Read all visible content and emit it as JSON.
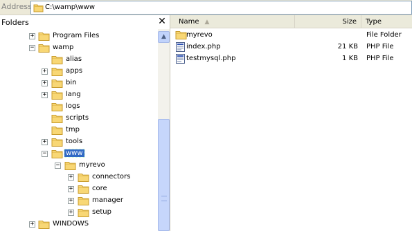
{
  "address": {
    "label": "Address",
    "path": "C:\\wamp\\www"
  },
  "folders_pane": {
    "title": "Folders",
    "close_glyph": "✕",
    "tree": [
      {
        "label": "Program Files",
        "expander": "+",
        "depth": 0,
        "selected": false
      },
      {
        "label": "wamp",
        "expander": "−",
        "depth": 0,
        "selected": false
      },
      {
        "label": "alias",
        "expander": "",
        "depth": 1,
        "selected": false
      },
      {
        "label": "apps",
        "expander": "+",
        "depth": 1,
        "selected": false
      },
      {
        "label": "bin",
        "expander": "+",
        "depth": 1,
        "selected": false
      },
      {
        "label": "lang",
        "expander": "+",
        "depth": 1,
        "selected": false
      },
      {
        "label": "logs",
        "expander": "",
        "depth": 1,
        "selected": false
      },
      {
        "label": "scripts",
        "expander": "",
        "depth": 1,
        "selected": false
      },
      {
        "label": "tmp",
        "expander": "",
        "depth": 1,
        "selected": false
      },
      {
        "label": "tools",
        "expander": "+",
        "depth": 1,
        "selected": false
      },
      {
        "label": "www",
        "expander": "−",
        "depth": 1,
        "selected": true
      },
      {
        "label": "myrevo",
        "expander": "−",
        "depth": 2,
        "selected": false
      },
      {
        "label": "connectors",
        "expander": "+",
        "depth": 3,
        "selected": false
      },
      {
        "label": "core",
        "expander": "+",
        "depth": 3,
        "selected": false
      },
      {
        "label": "manager",
        "expander": "+",
        "depth": 3,
        "selected": false
      },
      {
        "label": "setup",
        "expander": "+",
        "depth": 3,
        "selected": false
      },
      {
        "label": "WINDOWS",
        "expander": "+",
        "depth": 0,
        "selected": false
      }
    ]
  },
  "file_list": {
    "columns": {
      "name": "Name",
      "size": "Size",
      "type": "Type"
    },
    "rows": [
      {
        "name": "myrevo",
        "size": "",
        "type": "File Folder",
        "icon": "folder-icon"
      },
      {
        "name": "index.php",
        "size": "21 KB",
        "type": "PHP File",
        "icon": "php-file-icon"
      },
      {
        "name": "testmysql.php",
        "size": "1 KB",
        "type": "PHP File",
        "icon": "php-file-icon"
      }
    ]
  },
  "colors": {
    "selection": "#316ac5",
    "folder_fill": "#f8d775",
    "folder_edge": "#c89b2c",
    "toolbar_bg": "#ece9d8",
    "header_bg": "#ebeadb"
  }
}
